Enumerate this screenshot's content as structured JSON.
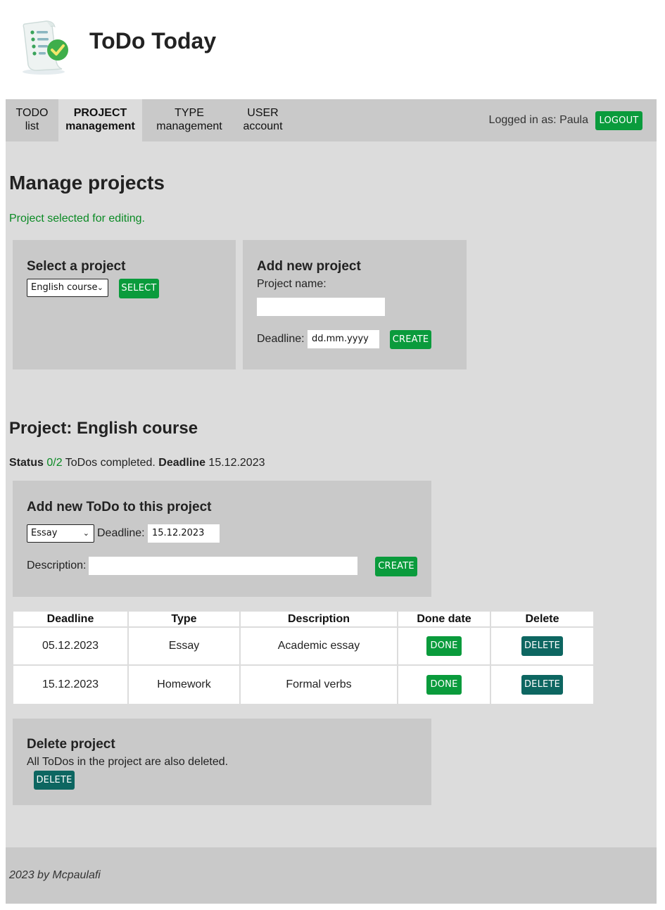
{
  "app": {
    "title": "ToDo Today"
  },
  "nav": {
    "items": [
      {
        "line1": "TODO",
        "line2": "list"
      },
      {
        "line1": "PROJECT",
        "line2": "management"
      },
      {
        "line1": "TYPE",
        "line2": "management"
      },
      {
        "line1": "USER",
        "line2": "account"
      }
    ],
    "active_index": 1,
    "logged_in_text": "Logged in as: Paula",
    "logout_label": "LOGOUT"
  },
  "page": {
    "heading": "Manage projects",
    "message": "Project selected for editing."
  },
  "select_project": {
    "title": "Select a project",
    "selected": "English course",
    "button": "SELECT"
  },
  "add_project": {
    "title": "Add new project",
    "name_label": "Project name:",
    "name_value": "",
    "deadline_label": "Deadline:",
    "deadline_placeholder": "dd.mm.yyyy",
    "button": "CREATE"
  },
  "project": {
    "heading": "Project: English course",
    "status_label": "Status",
    "status_value": "0/2",
    "status_text": "ToDos completed.",
    "deadline_label": "Deadline",
    "deadline_value": "15.12.2023"
  },
  "add_todo": {
    "title": "Add new ToDo to this project",
    "type_selected": "Essay",
    "deadline_label": "Deadline:",
    "deadline_value": "15.12.2023",
    "description_label": "Description:",
    "description_value": "",
    "button": "CREATE"
  },
  "todo_table": {
    "headers": [
      "Deadline",
      "Type",
      "Description",
      "Done date",
      "Delete"
    ],
    "rows": [
      {
        "deadline": "05.12.2023",
        "type": "Essay",
        "description": "Academic essay",
        "done_label": "DONE",
        "delete_label": "DELETE"
      },
      {
        "deadline": "15.12.2023",
        "type": "Homework",
        "description": "Formal verbs",
        "done_label": "DONE",
        "delete_label": "DELETE"
      }
    ]
  },
  "delete_project": {
    "title": "Delete project",
    "note": "All ToDos in the project are also deleted.",
    "button": "DELETE"
  },
  "footer": {
    "text": "2023 by Mcpaulafi"
  },
  "colors": {
    "primary_button": "#0a9b3c",
    "danger_button": "#0d6661",
    "success_text": "#0a8a24",
    "page_bg": "#dcdcdc",
    "panel_bg": "#c9c9c9"
  },
  "icons": {
    "logo": "checklist-scroll-icon",
    "select_chevron": "chevron-down-icon"
  }
}
